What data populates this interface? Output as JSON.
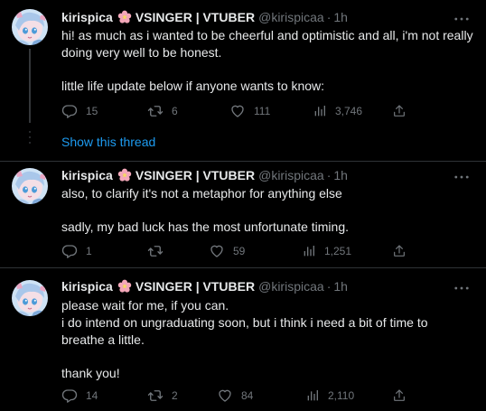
{
  "tweets": [
    {
      "name": "kirispica",
      "badge": "VSINGER | VTUBER",
      "handle": "@kirispicaa",
      "time": "1h",
      "paragraphs": [
        "hi! as much as i wanted to be cheerful and optimistic and all, i'm not really doing very well to be honest.",
        "little life update below if anyone wants to know:"
      ],
      "stats": {
        "replies": "15",
        "retweets": "6",
        "likes": "111",
        "views": "3,746"
      }
    },
    {
      "name": "kirispica",
      "badge": "VSINGER | VTUBER",
      "handle": "@kirispicaa",
      "time": "1h",
      "paragraphs": [
        "also, to clarify it's not a metaphor for anything else",
        "sadly, my bad luck has the most unfortunate timing."
      ],
      "stats": {
        "replies": "1",
        "retweets": "",
        "likes": "59",
        "views": "1,251"
      }
    },
    {
      "name": "kirispica",
      "badge": "VSINGER | VTUBER",
      "handle": "@kirispicaa",
      "time": "1h",
      "paragraphs": [
        "please wait for me, if you can.\ni do intend on ungraduating soon, but i think i need a bit of time to breathe a little.",
        "thank you!"
      ],
      "stats": {
        "replies": "14",
        "retweets": "2",
        "likes": "84",
        "views": "2,110"
      }
    }
  ],
  "show_thread": "Show this thread",
  "icons": {
    "reply": "reply-icon",
    "retweet": "retweet-icon",
    "like": "heart-icon",
    "views": "views-icon",
    "share": "share-icon",
    "more": "more-icon",
    "flower": "flower-icon"
  },
  "colors": {
    "background": "#000000",
    "text": "#e7e9ea",
    "muted": "#71767b",
    "link": "#1d9bf0",
    "flower": "#f4a7b9"
  }
}
